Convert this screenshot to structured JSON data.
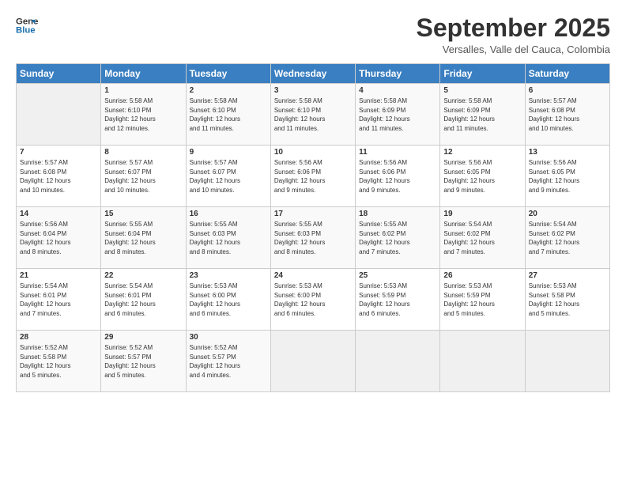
{
  "logo": {
    "line1": "General",
    "line2": "Blue"
  },
  "title": "September 2025",
  "subtitle": "Versalles, Valle del Cauca, Colombia",
  "days_of_week": [
    "Sunday",
    "Monday",
    "Tuesday",
    "Wednesday",
    "Thursday",
    "Friday",
    "Saturday"
  ],
  "weeks": [
    [
      {
        "day": "",
        "text": ""
      },
      {
        "day": "1",
        "text": "Sunrise: 5:58 AM\nSunset: 6:10 PM\nDaylight: 12 hours\nand 12 minutes."
      },
      {
        "day": "2",
        "text": "Sunrise: 5:58 AM\nSunset: 6:10 PM\nDaylight: 12 hours\nand 11 minutes."
      },
      {
        "day": "3",
        "text": "Sunrise: 5:58 AM\nSunset: 6:10 PM\nDaylight: 12 hours\nand 11 minutes."
      },
      {
        "day": "4",
        "text": "Sunrise: 5:58 AM\nSunset: 6:09 PM\nDaylight: 12 hours\nand 11 minutes."
      },
      {
        "day": "5",
        "text": "Sunrise: 5:58 AM\nSunset: 6:09 PM\nDaylight: 12 hours\nand 11 minutes."
      },
      {
        "day": "6",
        "text": "Sunrise: 5:57 AM\nSunset: 6:08 PM\nDaylight: 12 hours\nand 10 minutes."
      }
    ],
    [
      {
        "day": "7",
        "text": "Sunrise: 5:57 AM\nSunset: 6:08 PM\nDaylight: 12 hours\nand 10 minutes."
      },
      {
        "day": "8",
        "text": "Sunrise: 5:57 AM\nSunset: 6:07 PM\nDaylight: 12 hours\nand 10 minutes."
      },
      {
        "day": "9",
        "text": "Sunrise: 5:57 AM\nSunset: 6:07 PM\nDaylight: 12 hours\nand 10 minutes."
      },
      {
        "day": "10",
        "text": "Sunrise: 5:56 AM\nSunset: 6:06 PM\nDaylight: 12 hours\nand 9 minutes."
      },
      {
        "day": "11",
        "text": "Sunrise: 5:56 AM\nSunset: 6:06 PM\nDaylight: 12 hours\nand 9 minutes."
      },
      {
        "day": "12",
        "text": "Sunrise: 5:56 AM\nSunset: 6:05 PM\nDaylight: 12 hours\nand 9 minutes."
      },
      {
        "day": "13",
        "text": "Sunrise: 5:56 AM\nSunset: 6:05 PM\nDaylight: 12 hours\nand 9 minutes."
      }
    ],
    [
      {
        "day": "14",
        "text": "Sunrise: 5:56 AM\nSunset: 6:04 PM\nDaylight: 12 hours\nand 8 minutes."
      },
      {
        "day": "15",
        "text": "Sunrise: 5:55 AM\nSunset: 6:04 PM\nDaylight: 12 hours\nand 8 minutes."
      },
      {
        "day": "16",
        "text": "Sunrise: 5:55 AM\nSunset: 6:03 PM\nDaylight: 12 hours\nand 8 minutes."
      },
      {
        "day": "17",
        "text": "Sunrise: 5:55 AM\nSunset: 6:03 PM\nDaylight: 12 hours\nand 8 minutes."
      },
      {
        "day": "18",
        "text": "Sunrise: 5:55 AM\nSunset: 6:02 PM\nDaylight: 12 hours\nand 7 minutes."
      },
      {
        "day": "19",
        "text": "Sunrise: 5:54 AM\nSunset: 6:02 PM\nDaylight: 12 hours\nand 7 minutes."
      },
      {
        "day": "20",
        "text": "Sunrise: 5:54 AM\nSunset: 6:02 PM\nDaylight: 12 hours\nand 7 minutes."
      }
    ],
    [
      {
        "day": "21",
        "text": "Sunrise: 5:54 AM\nSunset: 6:01 PM\nDaylight: 12 hours\nand 7 minutes."
      },
      {
        "day": "22",
        "text": "Sunrise: 5:54 AM\nSunset: 6:01 PM\nDaylight: 12 hours\nand 6 minutes."
      },
      {
        "day": "23",
        "text": "Sunrise: 5:53 AM\nSunset: 6:00 PM\nDaylight: 12 hours\nand 6 minutes."
      },
      {
        "day": "24",
        "text": "Sunrise: 5:53 AM\nSunset: 6:00 PM\nDaylight: 12 hours\nand 6 minutes."
      },
      {
        "day": "25",
        "text": "Sunrise: 5:53 AM\nSunset: 5:59 PM\nDaylight: 12 hours\nand 6 minutes."
      },
      {
        "day": "26",
        "text": "Sunrise: 5:53 AM\nSunset: 5:59 PM\nDaylight: 12 hours\nand 5 minutes."
      },
      {
        "day": "27",
        "text": "Sunrise: 5:53 AM\nSunset: 5:58 PM\nDaylight: 12 hours\nand 5 minutes."
      }
    ],
    [
      {
        "day": "28",
        "text": "Sunrise: 5:52 AM\nSunset: 5:58 PM\nDaylight: 12 hours\nand 5 minutes."
      },
      {
        "day": "29",
        "text": "Sunrise: 5:52 AM\nSunset: 5:57 PM\nDaylight: 12 hours\nand 5 minutes."
      },
      {
        "day": "30",
        "text": "Sunrise: 5:52 AM\nSunset: 5:57 PM\nDaylight: 12 hours\nand 4 minutes."
      },
      {
        "day": "",
        "text": ""
      },
      {
        "day": "",
        "text": ""
      },
      {
        "day": "",
        "text": ""
      },
      {
        "day": "",
        "text": ""
      }
    ]
  ]
}
